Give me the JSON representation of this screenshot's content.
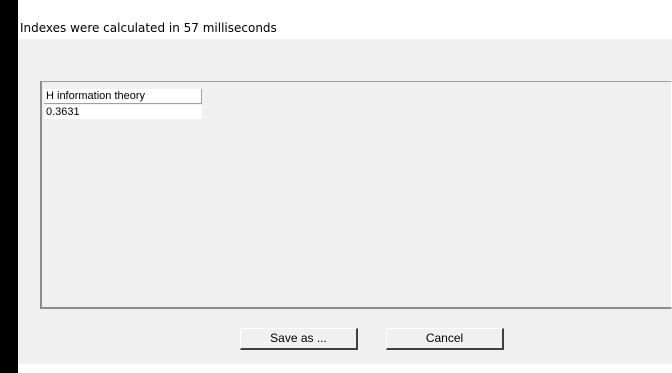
{
  "window": {
    "title": "Indexes were calculated in 57 milliseconds"
  },
  "grid": {
    "columns": [
      "H information theory"
    ],
    "rows": [
      [
        "0.3631"
      ]
    ]
  },
  "buttons": {
    "save_label": "Save as ...",
    "cancel_label": "Cancel"
  }
}
